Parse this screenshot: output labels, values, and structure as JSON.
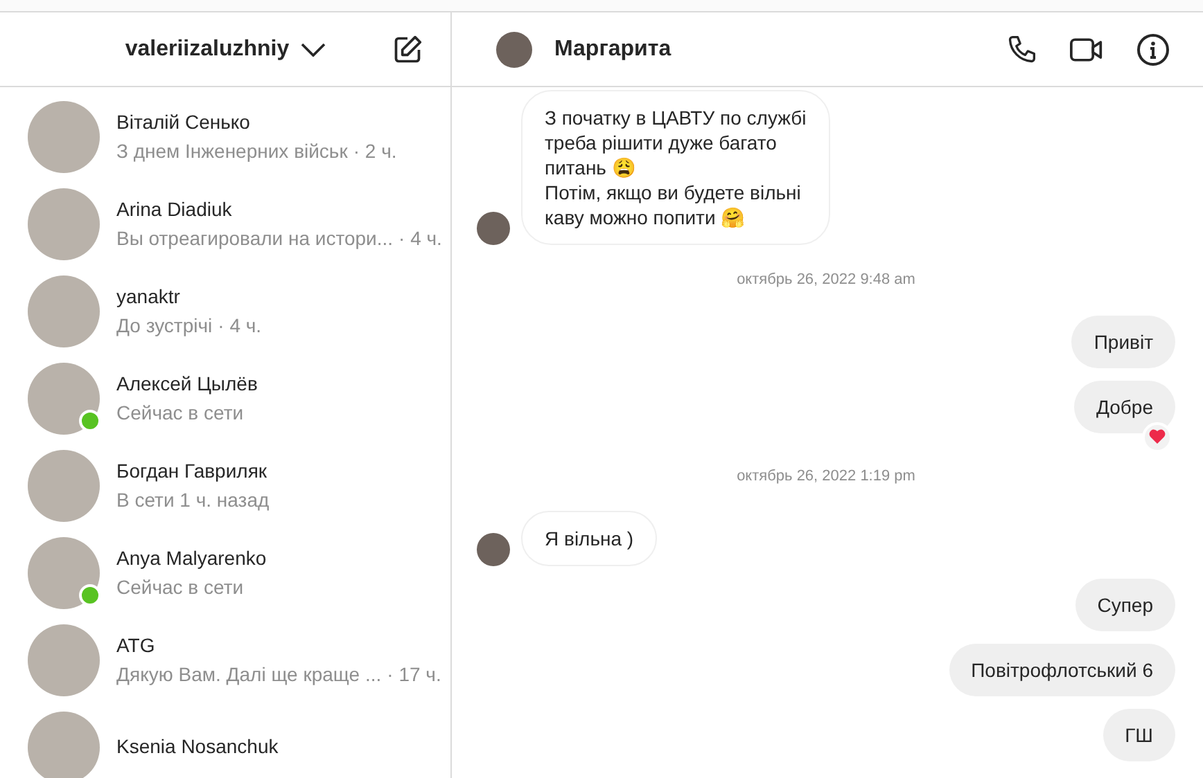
{
  "sidebar": {
    "account": "valeriizaluzhniy",
    "chats": [
      {
        "name": "Віталій Сенько",
        "preview": "З днем Інженерних військ",
        "time": "· 2 ч.",
        "online": false
      },
      {
        "name": "Arina Diadiuk",
        "preview": "Вы отреагировали на истори...",
        "time": "· 4 ч.",
        "online": false
      },
      {
        "name": "yanaktr",
        "preview": "До зустрічі",
        "time": "· 4 ч.",
        "online": false
      },
      {
        "name": "Алексей Цылёв",
        "preview": "Сейчас в сети",
        "online": true
      },
      {
        "name": "Богдан Гавриляк",
        "preview": "В сети 1 ч. назад",
        "online": false
      },
      {
        "name": "Anya Malyarenko",
        "preview": "Сейчас в сети",
        "online": true
      },
      {
        "name": "ATG",
        "preview": "Дякую Вам. Далі ще краще ...",
        "time": "· 17 ч.",
        "online": false
      },
      {
        "name": "Ksenia Nosanchuk",
        "online": false
      }
    ]
  },
  "chat": {
    "title": "Маргарита",
    "messages": [
      {
        "kind": "incoming",
        "text": "З початку в ЦАВТУ по службі\nтреба рішити дуже багато\nпитань 😩\nПотім, якщо ви будете вільні\nкаву можно попити 🤗"
      },
      {
        "kind": "timestamp",
        "text": "октябрь 26, 2022 9:48 am"
      },
      {
        "kind": "outgoing",
        "text": "Привіт",
        "liked": false
      },
      {
        "kind": "outgoing",
        "text": "Добре",
        "liked": true
      },
      {
        "kind": "timestamp",
        "text": "октябрь 26, 2022 1:19 pm"
      },
      {
        "kind": "incoming",
        "text": "Я вільна )"
      },
      {
        "kind": "outgoing",
        "text": "Супер",
        "liked": false
      },
      {
        "kind": "outgoing",
        "text": "Повітрофлотський 6",
        "liked": false
      },
      {
        "kind": "outgoing",
        "text": "ГШ",
        "liked": false
      }
    ]
  }
}
